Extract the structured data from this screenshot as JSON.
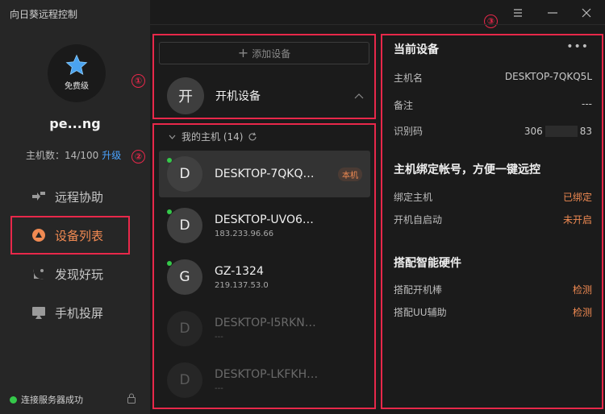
{
  "app": {
    "title": "向日葵远程控制"
  },
  "profile": {
    "tier": "免费级",
    "username": "pe...ng",
    "host_count": "主机数：14/100",
    "upgrade": "升级"
  },
  "nav": [
    {
      "id": "remote-assist",
      "label": "远程协助",
      "icon": "remote-assist-icon",
      "active": false
    },
    {
      "id": "device-list",
      "label": "设备列表",
      "icon": "device-list-icon",
      "active": true
    },
    {
      "id": "discover",
      "label": "发现好玩",
      "icon": "discover-icon",
      "active": false
    },
    {
      "id": "screen-cast",
      "label": "手机投屏",
      "icon": "screen-cast-icon",
      "active": false
    }
  ],
  "status": {
    "text": "连接服务器成功",
    "color": "#35c94a"
  },
  "annotations": [
    "①",
    "②",
    "③"
  ],
  "middle": {
    "add_device": "添加设备",
    "boot_device": {
      "avatar": "开",
      "label": "开机设备"
    },
    "group": {
      "label": "我的主机 (14)"
    },
    "devices": [
      {
        "avatar": "D",
        "name": "DESKTOP-7QKQ5L…",
        "ip": "",
        "online": true,
        "selected": true,
        "badge": "本机"
      },
      {
        "avatar": "D",
        "name": "DESKTOP-UVO6R4F",
        "ip": "183.233.96.66",
        "online": true,
        "selected": false,
        "badge": ""
      },
      {
        "avatar": "G",
        "name": "GZ-1324",
        "ip": "219.137.53.0",
        "online": true,
        "selected": false,
        "badge": ""
      },
      {
        "avatar": "D",
        "name": "DESKTOP-I5RKNBD",
        "ip": "---",
        "online": false,
        "selected": false,
        "badge": ""
      },
      {
        "avatar": "D",
        "name": "DESKTOP-LKFKH7B",
        "ip": "---",
        "online": false,
        "selected": false,
        "badge": ""
      }
    ]
  },
  "right": {
    "title": "当前设备",
    "more": "•••",
    "hostname": {
      "label": "主机名",
      "value": "DESKTOP-7QKQ5L"
    },
    "remark": {
      "label": "备注",
      "value": "---"
    },
    "identifier": {
      "label": "识别码",
      "prefix": "306",
      "suffix": "83"
    },
    "bind_section": "主机绑定帐号，方便一键远控",
    "bound": {
      "label": "绑定主机",
      "value": "已绑定"
    },
    "autostart": {
      "label": "开机自启动",
      "value": "未开启"
    },
    "hardware_section": "搭配智能硬件",
    "boot_stick": {
      "label": "搭配开机棒",
      "value": "检测"
    },
    "uu_assist": {
      "label": "搭配UU辅助",
      "value": "检测"
    }
  },
  "colors": {
    "accent": "#f08a52",
    "highlight": "#e8284a",
    "link": "#4aa3ff",
    "online": "#35c94a"
  }
}
